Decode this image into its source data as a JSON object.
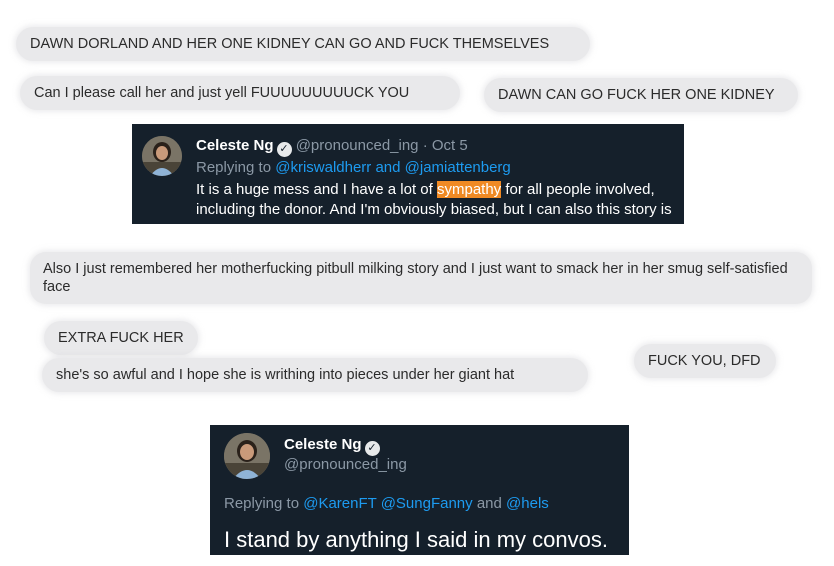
{
  "messages": {
    "m1": "DAWN DORLAND AND HER ONE KIDNEY CAN GO AND FUCK THEMSELVES",
    "m2": "Can I please call her and just yell FUUUUUUUUUCK YOU",
    "m3": "DAWN CAN GO FUCK HER ONE KIDNEY",
    "m4": "Also I just remembered her motherfucking pitbull milking story and I just want to smack her in her smug self-satisfied face",
    "m5": "EXTRA FUCK HER",
    "m6": "she's so awful and I hope she is writhing into pieces under her giant hat",
    "m7": "FUCK YOU, DFD"
  },
  "tweet1": {
    "name": "Celeste Ng",
    "handle": "@pronounced_ing",
    "date": "· Oct 5",
    "replying_prefix": "Replying to ",
    "replying_to": "@kriswaldherr and @jamiattenberg",
    "text_before": "It is a huge mess and I have a lot of ",
    "highlight": "sympathy",
    "text_after": " for all people involved, including the donor. And I'm obviously biased, but I can also this story is"
  },
  "tweet2": {
    "name": "Celeste Ng",
    "handle": "@pronounced_ing",
    "replying_prefix": "Replying to ",
    "mention1": "@KarenFT",
    "mention2": "@SungFanny",
    "and_word": " and ",
    "mention3": "@hels",
    "text": "I stand by anything I said in my convos."
  },
  "icons": {
    "verified": "verified-check-icon",
    "avatar": "profile-avatar"
  },
  "colors": {
    "bubble": "#e9e9eb",
    "tweet_bg": "#15202b",
    "link": "#1d9bf0",
    "highlight": "#f08a24"
  }
}
